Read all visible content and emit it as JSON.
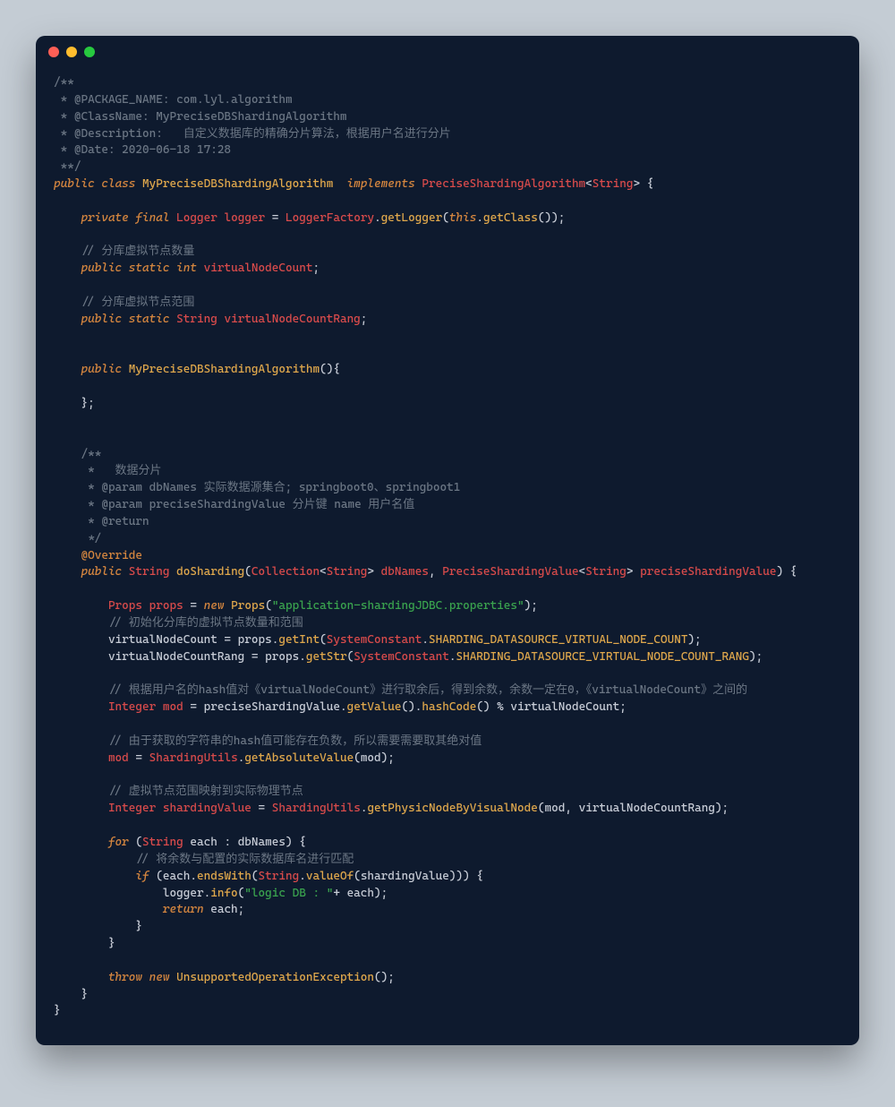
{
  "header_comment": {
    "l1": "/**",
    "l2": " * @PACKAGE_NAME: com.lyl.algorithm",
    "l3": " * @ClassName: MyPreciseDBShardingAlgorithm",
    "l4": " * @Description:   自定义数据库的精确分片算法，根据用户名进行分片",
    "l5": " * @Date: 2020-06-18 17:28",
    "l6": " **/"
  },
  "decl": {
    "public": "public",
    "class": "class",
    "classname": "MyPreciseDBShardingAlgorithm",
    "implements": "implements",
    "iface": "PreciseShardingAlgorithm",
    "generic_l": "<",
    "generic_t": "String",
    "generic_r": "> {"
  },
  "logger": {
    "private": "private",
    "final": "final",
    "type": "Logger",
    "name": "logger",
    "eq": " = ",
    "factory": "LoggerFactory",
    "dot1": ".",
    "get": "getLogger",
    "lp": "(",
    "this": "this",
    "dot2": ".",
    "getclass": "getClass",
    "rp": "());"
  },
  "c_vnc": "// 分库虚拟节点数量",
  "vnc": {
    "public": "public",
    "static": "static",
    "int": "int",
    "name": "virtualNodeCount",
    "sc": ";"
  },
  "c_vncr": "// 分库虚拟节点范围",
  "vncr": {
    "public": "public",
    "static": "static",
    "str": "String",
    "name": "virtualNodeCountRang",
    "sc": ";"
  },
  "ctor": {
    "public": "public",
    "name": "MyPreciseDBShardingAlgorithm",
    "body": "(){",
    "close": "};"
  },
  "method_comment": {
    "l1": "/**",
    "l2": " *   数据分片",
    "l3": " * @param dbNames 实际数据源集合; springboot0、springboot1",
    "l4": " * @param preciseShardingValue 分片键 name 用户名值",
    "l5": " * @return",
    "l6": " */"
  },
  "override": "@Override",
  "method": {
    "public": "public",
    "ret": "String",
    "name": "doSharding",
    "lp": "(",
    "coll": "Collection",
    "g1": "<",
    "g1t": "String",
    "g1c": "> ",
    "p1": "dbNames",
    ", ": ", ",
    "psv": "PreciseShardingValue",
    "g2": "<",
    "g2t": "String",
    "g2c": "> ",
    "p2": "preciseShardingValue",
    "rp": ") {"
  },
  "props_line": {
    "type": "Props",
    "name": "props",
    "eq": " = ",
    "new": "new",
    "ctor": "Props",
    "lp": "(",
    "str": "\"application-shardingJDBC.properties\"",
    "rp": ");"
  },
  "c_init": "// 初始化分库的虚拟节点数量和范围",
  "init_vnc": {
    "lhs": "virtualNodeCount",
    "eq": " = ",
    "obj": "props",
    "dot": ".",
    "m": "getInt",
    "lp": "(",
    "cls": "SystemConstant",
    "dot2": ".",
    "k": "SHARDING_DATASOURCE_VIRTUAL_NODE_COUNT",
    "rp": ");"
  },
  "init_vncr": {
    "lhs": "virtualNodeCountRang",
    "eq": " = ",
    "obj": "props",
    "dot": ".",
    "m": "getStr",
    "lp": "(",
    "cls": "SystemConstant",
    "dot2": ".",
    "k": "SHARDING_DATASOURCE_VIRTUAL_NODE_COUNT_RANG",
    "rp": ");"
  },
  "c_mod": "// 根据用户名的hash值对《virtualNodeCount》进行取余后，得到余数，余数一定在0，《virtualNodeCount》之间的",
  "mod_line": {
    "type": "Integer",
    "name": "mod",
    "eq": " = ",
    "obj": "preciseShardingValue",
    "dot": ".",
    "m1": "getValue",
    "p1": "().",
    "m2": "hashCode",
    "p2": "() % ",
    "rhs": "virtualNodeCount",
    "sc": ";"
  },
  "c_abs": "// 由于获取的字符串的hash值可能存在负数，所以需要需要取其绝对值",
  "abs_line": {
    "lhs": "mod",
    "eq": " = ",
    "cls": "ShardingUtils",
    "dot": ".",
    "m": "getAbsoluteValue",
    "lp": "(",
    "arg": "mod",
    "rp": ");"
  },
  "c_map": "// 虚拟节点范围映射到实际物理节点",
  "map_line": {
    "type": "Integer",
    "name": "shardingValue",
    "eq": " = ",
    "cls": "ShardingUtils",
    "dot": ".",
    "m": "getPhysicNodeByVisualNode",
    "lp": "(",
    "a1": "mod",
    ", ": ", ",
    "a2": "virtualNodeCountRang",
    "rp": ");"
  },
  "for_line": {
    "for": "for",
    "lp": " (",
    "type": "String",
    "each": "each",
    "colon": " : ",
    "coll": "dbNames",
    "rp": ") {"
  },
  "c_match": "// 将余数与配置的实际数据库名进行匹配",
  "if_line": {
    "if": "if",
    "lp": " (",
    "obj": "each",
    "dot": ".",
    "m": "endsWith",
    "lp2": "(",
    "cls": "String",
    "dot2": ".",
    "m2": "valueOf",
    "lp3": "(",
    "arg": "shardingValue",
    "rp": "))) {"
  },
  "log_line": {
    "obj": "logger",
    "dot": ".",
    "m": "info",
    "lp": "(",
    "str": "\"logic DB : \"",
    "plus": "+ ",
    "arg": "each",
    "rp": ");"
  },
  "return_line": {
    "ret": "return",
    "arg": "each",
    "sc": ";"
  },
  "brace_close": "}",
  "throw_line": {
    "throw": "throw",
    "new": "new",
    "cls": "UnsupportedOperationException",
    "p": "();"
  }
}
